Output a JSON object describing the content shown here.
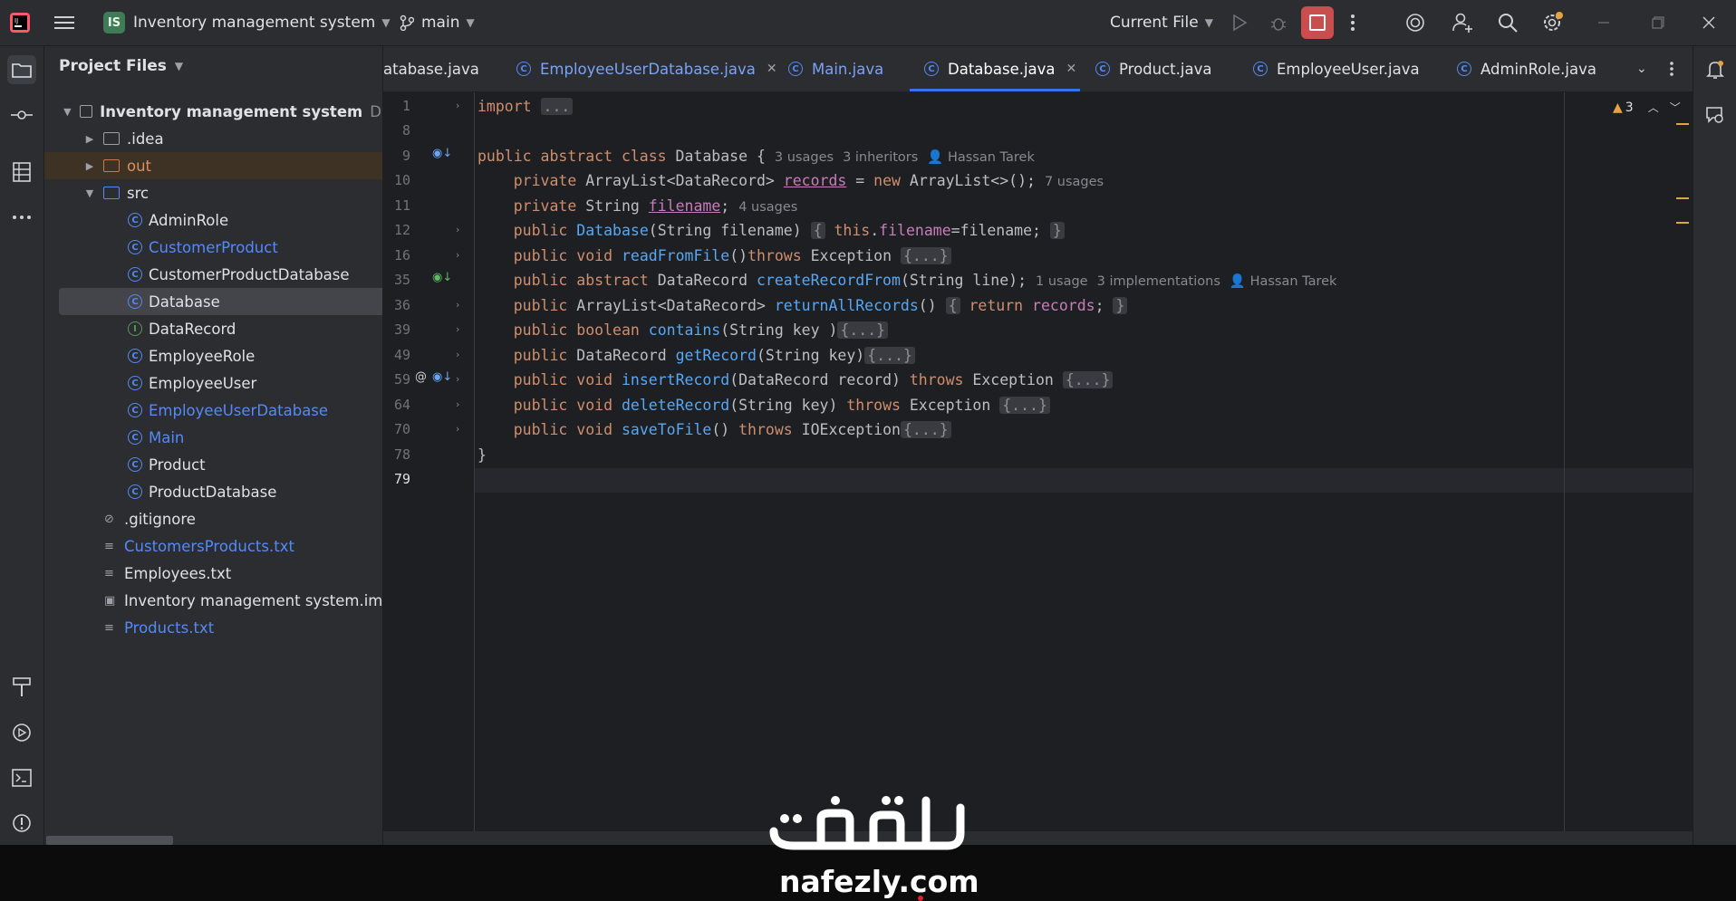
{
  "titlebar": {
    "project_badge": "IS",
    "project_name": "Inventory management system",
    "branch": "main",
    "run_config": "Current File"
  },
  "project_panel": {
    "title": "Project Files",
    "root_label": "Inventory management system",
    "root_path": "D:\\P",
    "items": [
      {
        "label": ".idea",
        "kind": "folder"
      },
      {
        "label": "out",
        "kind": "folder-excluded"
      },
      {
        "label": "src",
        "kind": "folder-source"
      },
      {
        "label": "AdminRole",
        "kind": "class"
      },
      {
        "label": "CustomerProduct",
        "kind": "class"
      },
      {
        "label": "CustomerProductDatabase",
        "kind": "class"
      },
      {
        "label": "Database",
        "kind": "abstract-class"
      },
      {
        "label": "DataRecord",
        "kind": "interface"
      },
      {
        "label": "EmployeeRole",
        "kind": "class"
      },
      {
        "label": "EmployeeUser",
        "kind": "class"
      },
      {
        "label": "EmployeeUserDatabase",
        "kind": "class"
      },
      {
        "label": "Main",
        "kind": "class"
      },
      {
        "label": "Product",
        "kind": "class"
      },
      {
        "label": "ProductDatabase",
        "kind": "class"
      },
      {
        "label": ".gitignore",
        "kind": "ignore-file"
      },
      {
        "label": "CustomersProducts.txt",
        "kind": "text-file"
      },
      {
        "label": "Employees.txt",
        "kind": "text-file"
      },
      {
        "label": "Inventory management system.iml",
        "kind": "module-file"
      },
      {
        "label": "Products.txt",
        "kind": "text-file"
      }
    ]
  },
  "tabs": [
    {
      "label": "atabase.java"
    },
    {
      "label": "EmployeeUserDatabase.java"
    },
    {
      "label": "Main.java"
    },
    {
      "label": "Database.java",
      "active": true
    },
    {
      "label": "Product.java"
    },
    {
      "label": "EmployeeUser.java"
    },
    {
      "label": "AdminRole.java"
    }
  ],
  "editor": {
    "line_numbers": [
      "1",
      "8",
      "9",
      "10",
      "11",
      "12",
      "16",
      "35",
      "36",
      "39",
      "49",
      "59",
      "64",
      "70",
      "78",
      "79"
    ],
    "fold_placeholder_import": "...",
    "fold_placeholder": "{...}",
    "hints": {
      "class_usages": "3 usages",
      "class_inheritors": "3 inheritors",
      "author": "Hassan Tarek",
      "records_usages": "7 usages",
      "filename_usages": "4 usages",
      "create_usages": "1 usage",
      "create_impls": "3 implementations"
    },
    "warning_count": "3"
  },
  "watermark": {
    "arabic": "نفذلي",
    "latin": "nafezly.com"
  },
  "colors": {
    "accent": "#3574f0",
    "keyword": "#cf8e6d",
    "function": "#56a8f5",
    "field": "#c77dbb",
    "stop_button": "#c94f4f"
  }
}
